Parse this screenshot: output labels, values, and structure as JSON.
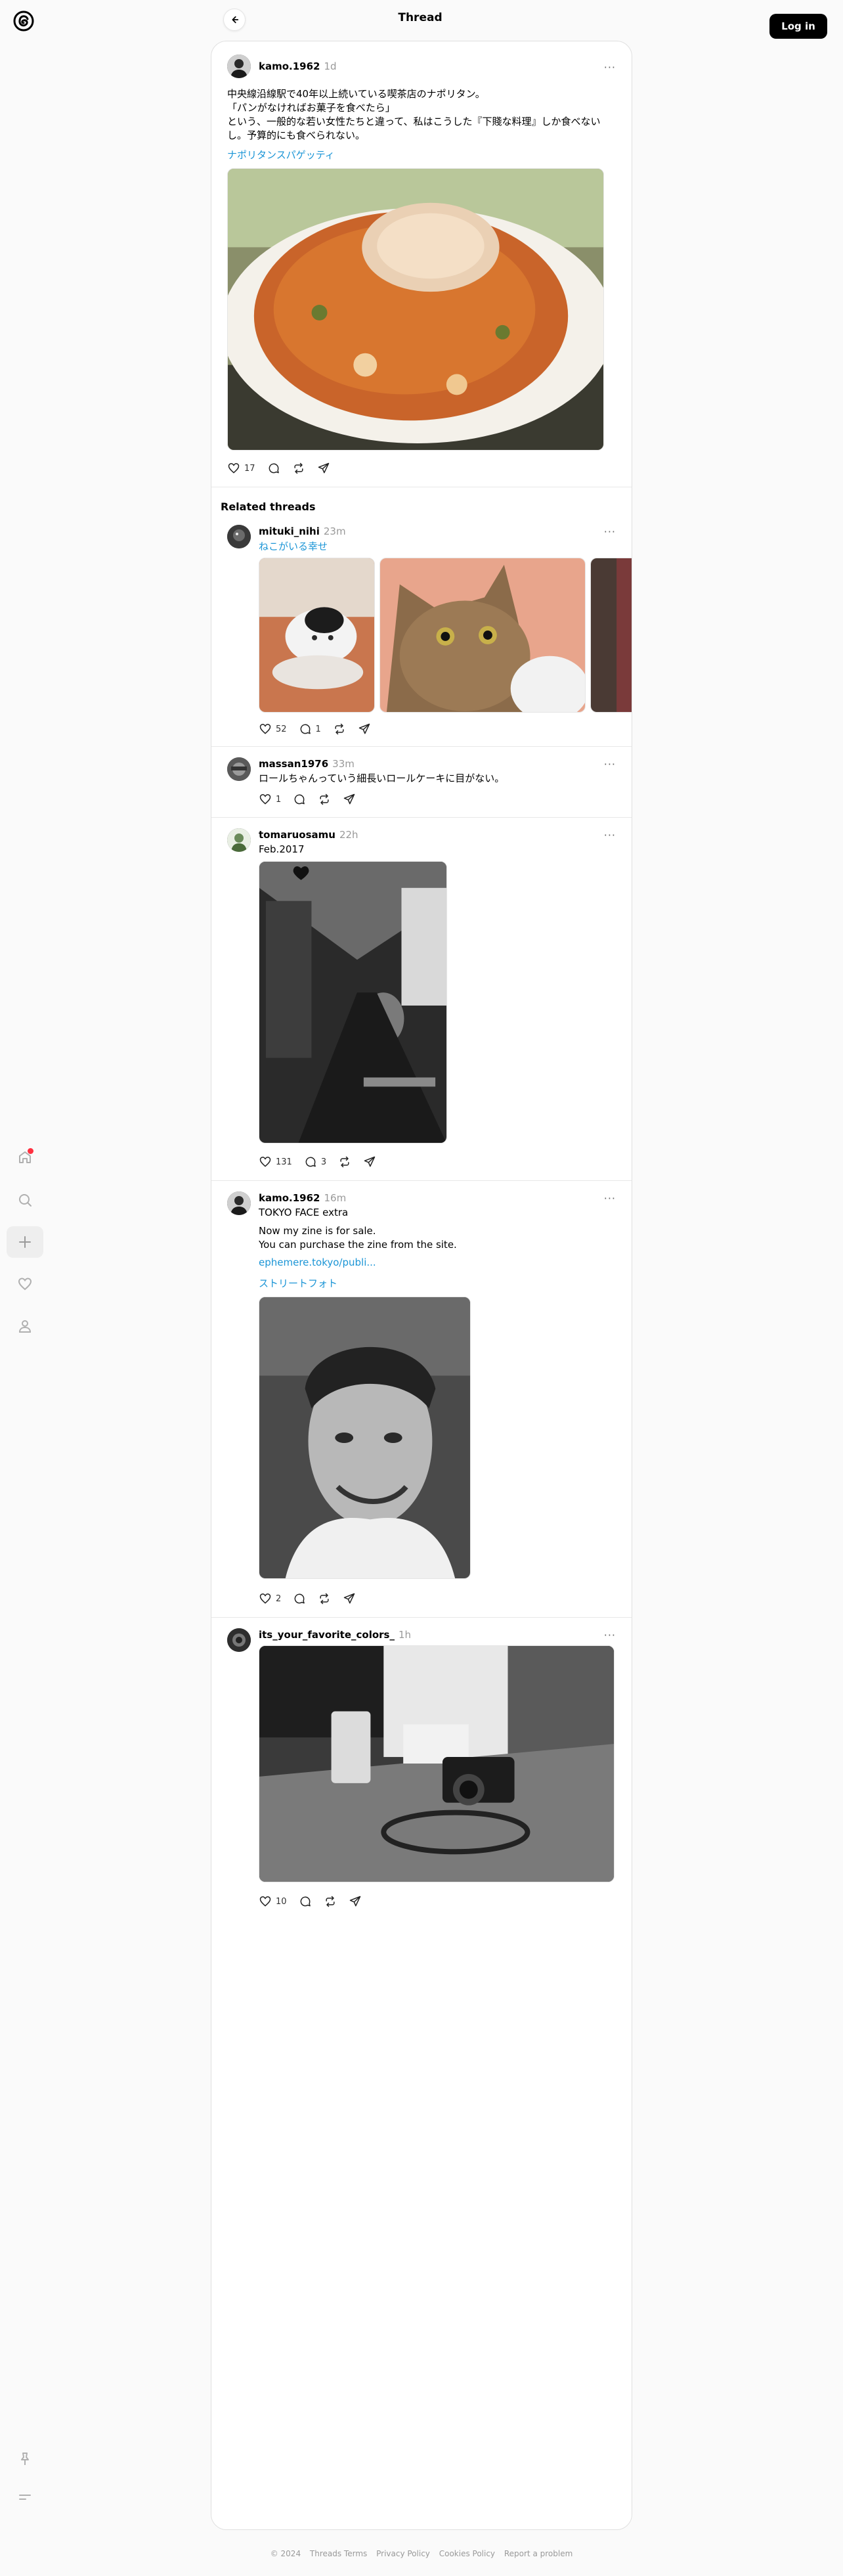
{
  "header": {
    "title": "Thread",
    "login_label": "Log in"
  },
  "nav": {
    "items": [
      "home-icon",
      "search-icon",
      "plus-icon",
      "heart-icon",
      "profile-icon"
    ],
    "bottom": [
      "pin-icon",
      "menu-icon"
    ]
  },
  "main_post": {
    "username": "kamo.1962",
    "time": "1d",
    "lines": [
      "中央線沿線駅で40年以上続いている喫茶店のナポリタン。",
      "「パンがなければお菓子を食べたら」",
      "という、一般的な若い女性たちと違って、私はこうした『下賤な料理』しか食べない",
      "し。予算的にも食べられない。"
    ],
    "tag": "ナポリタンスパゲッティ",
    "likes": "17"
  },
  "related_heading": "Related threads",
  "related": [
    {
      "username": "mituki_nihi",
      "time": "23m",
      "tag": "ねこがいる幸せ",
      "likes": "52",
      "replies": "1"
    },
    {
      "username": "massan1976",
      "time": "33m",
      "text": "ロールちゃんっていう細長いロールケーキに目がない。",
      "likes": "1"
    },
    {
      "username": "tomaruosamu",
      "time": "22h",
      "text": "Feb.2017",
      "likes": "131",
      "replies": "3"
    },
    {
      "username": "kamo.1962",
      "time": "16m",
      "title": "TOKYO FACE extra",
      "lines": [
        "Now my zine is for sale.",
        "You can purchase the zine from the site."
      ],
      "link": "ephemere.tokyo/publi...",
      "tag": "ストリートフォト",
      "likes": "2"
    },
    {
      "username": "its_your_favorite_colors_",
      "time": "1h",
      "likes": "10"
    }
  ],
  "footer": [
    "© 2024",
    "Threads Terms",
    "Privacy Policy",
    "Cookies Policy",
    "Report a problem"
  ],
  "colors": {
    "accent_link": "#1b95d6",
    "notification_dot": "#ff3040"
  }
}
